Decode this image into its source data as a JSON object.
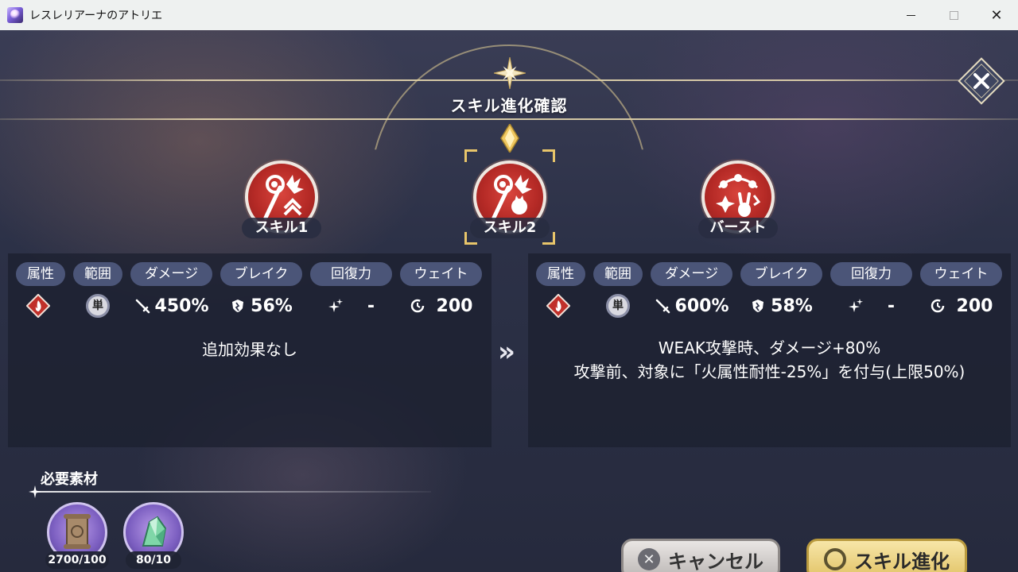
{
  "window": {
    "title": "レスレリアーナのアトリエ"
  },
  "header": {
    "title": "スキル進化確認"
  },
  "skills": [
    {
      "label": "スキル1",
      "icon": "staff-fire-skill-icon"
    },
    {
      "label": "スキル2",
      "icon": "staff-fire-skill-icon",
      "selected": true
    },
    {
      "label": "バースト",
      "icon": "burst-skill-icon"
    }
  ],
  "stat_headers": [
    "属性",
    "範囲",
    "ダメージ",
    "ブレイク",
    "回復力",
    "ウェイト"
  ],
  "before": {
    "attribute": "fire",
    "range": "単",
    "damage": "450%",
    "break": "56%",
    "heal": "-",
    "wait": "200",
    "effects": [
      "追加効果なし"
    ]
  },
  "after": {
    "attribute": "fire",
    "range": "単",
    "damage": "600%",
    "break": "58%",
    "heal": "-",
    "wait": "200",
    "effects": [
      "WEAK攻撃時、ダメージ+80%",
      "攻撃前、対象に「火属性耐性-25%」を付与(上限50%)"
    ]
  },
  "arrow": "»",
  "materials": {
    "title": "必要素材",
    "items": [
      {
        "icon": "scroll-icon",
        "count": "2700/100"
      },
      {
        "icon": "green-crystal-icon",
        "count": "80/10"
      }
    ]
  },
  "buttons": {
    "cancel": "キャンセル",
    "confirm": "スキル進化"
  },
  "colors": {
    "skill_red": "#c0302a",
    "stat_tag": "#4b5578",
    "confirm_gold": "#e9cf7c"
  }
}
